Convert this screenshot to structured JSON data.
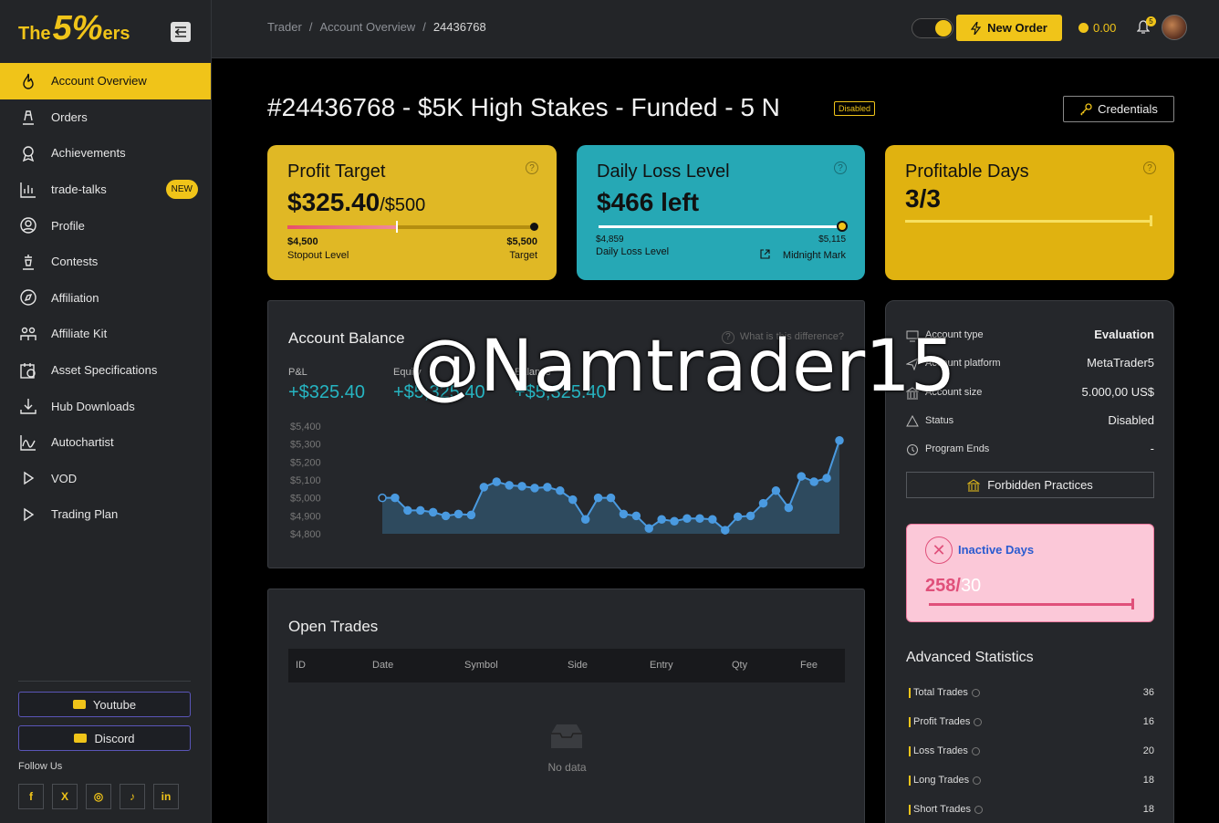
{
  "brand": {
    "the": "The",
    "five": "5%",
    "ers": "ers"
  },
  "sidebar": {
    "items": [
      {
        "label": "Account Overview",
        "icon": "fire-icon",
        "active": true
      },
      {
        "label": "Orders",
        "icon": "orders-icon"
      },
      {
        "label": "Achievements",
        "icon": "medal-icon"
      },
      {
        "label": "trade-talks",
        "icon": "chart-bars-icon",
        "badge": "NEW"
      },
      {
        "label": "Profile",
        "icon": "user-icon"
      },
      {
        "label": "Contests",
        "icon": "contest-icon"
      },
      {
        "label": "Affiliation",
        "icon": "compass-icon"
      },
      {
        "label": "Affiliate Kit",
        "icon": "people-icon"
      },
      {
        "label": "Asset Specifications",
        "icon": "calendar-clock-icon"
      },
      {
        "label": "Hub Downloads",
        "icon": "download-icon"
      },
      {
        "label": "Autochartist",
        "icon": "chart-line-icon"
      },
      {
        "label": "VOD",
        "icon": "play-icon"
      },
      {
        "label": "Trading Plan",
        "icon": "play-icon"
      }
    ],
    "youtube": "Youtube",
    "discord": "Discord",
    "follow": "Follow Us",
    "social": [
      "f",
      "X",
      "◎",
      "♪",
      "in"
    ]
  },
  "header": {
    "crumbs": [
      "Trader",
      "/",
      "Account Overview",
      "/",
      "24436768"
    ],
    "new_order": "New Order",
    "coins": "0.00",
    "bell_count": "5"
  },
  "main": {
    "title": "#24436768 - $5K High Stakes - Funded - 5 N",
    "status_badge": "Disabled",
    "credentials": "Credentials"
  },
  "cards": {
    "profit": {
      "title": "Profit Target",
      "value": "$325.40",
      "sub": "/$500",
      "left_val": "$4,500",
      "left_lbl": "Stopout Level",
      "right_val": "$5,500",
      "right_lbl": "Target",
      "progress": 0.65
    },
    "loss": {
      "title": "Daily Loss Level",
      "value": "$466 left",
      "left_val": "$4,859",
      "left_lbl": "Daily Loss Level",
      "right_val": "$5,115",
      "right_lbl": "Midnight Mark",
      "progress": 1.0
    },
    "days": {
      "title": "Profitable Days",
      "value": "3/3",
      "progress": 1.0
    }
  },
  "account_balance": {
    "title": "Account Balance",
    "help": "What is this difference?",
    "pnl_label": "P&L",
    "pnl": "+$325.40",
    "equity_label": "Equity",
    "equity": "+$5,325.40",
    "balance_label": "Balance",
    "balance": "+$5,325.40"
  },
  "chart_data": {
    "type": "area",
    "title": "Account Balance",
    "ylim": [
      4800,
      5400
    ],
    "yticks": [
      "$5,400",
      "$5,300",
      "$5,200",
      "$5,100",
      "$5,000",
      "$4,900",
      "$4,800"
    ],
    "series": [
      {
        "values": [
          5000,
          5000,
          4930,
          4930,
          4920,
          4900,
          4910,
          4905,
          5060,
          5090,
          5070,
          5065,
          5055,
          5060,
          5040,
          4990,
          4880,
          5000,
          5000,
          4910,
          4900,
          4830,
          4880,
          4870,
          4885,
          4885,
          4880,
          4820,
          4895,
          4900,
          4970,
          5040,
          4945,
          5120,
          5090,
          5110,
          5320
        ]
      }
    ]
  },
  "open_trades": {
    "title": "Open Trades",
    "columns": [
      "ID",
      "Date",
      "Symbol",
      "Side",
      "Entry",
      "Qty",
      "Fee"
    ],
    "empty": "No data"
  },
  "info": {
    "rows": [
      {
        "k": "Account type",
        "v": "Evaluation"
      },
      {
        "k": "Account platform",
        "v": "MetaTrader5"
      },
      {
        "k": "Account size",
        "v": "5.000,00 US$"
      },
      {
        "k": "Status",
        "v": "Disabled"
      },
      {
        "k": "Program Ends",
        "v": "-"
      }
    ],
    "forbidden": "Forbidden Practices",
    "inactive_title": "Inactive Days",
    "inactive_val": "258/",
    "inactive_tot": "30",
    "adv_title": "Advanced Statistics",
    "adv": [
      {
        "k": "Total Trades",
        "v": "36"
      },
      {
        "k": "Profit Trades",
        "v": "16"
      },
      {
        "k": "Loss Trades",
        "v": "20"
      },
      {
        "k": "Long Trades",
        "v": "18"
      },
      {
        "k": "Short Trades",
        "v": "18"
      }
    ]
  },
  "watermark": "@Namtrader15",
  "colors": {
    "accent": "#f0c419",
    "teal": "#26a8b5",
    "pink": "#fbc8d8"
  }
}
